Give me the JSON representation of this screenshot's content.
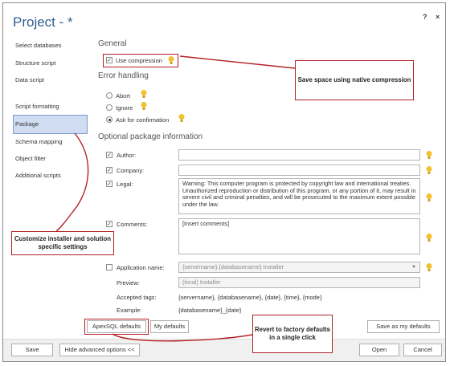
{
  "window": {
    "title": "Project - *",
    "help_label": "?",
    "close_label": "×"
  },
  "sidebar": {
    "items": [
      {
        "label": "Select databases"
      },
      {
        "label": "Structure script"
      },
      {
        "label": "Data script"
      },
      {
        "label": "Script formatting"
      },
      {
        "label": "Package"
      },
      {
        "label": "Schema mapping"
      },
      {
        "label": "Object filter"
      },
      {
        "label": "Additional scripts"
      }
    ],
    "active": "Package"
  },
  "general": {
    "heading": "General",
    "use_compression": {
      "label": "Use compression",
      "checked": true
    }
  },
  "error_handling": {
    "heading": "Error handling",
    "options": [
      {
        "label": "Abort",
        "selected": false
      },
      {
        "label": "Ignore",
        "selected": false
      },
      {
        "label": "Ask for confirmation",
        "selected": true
      }
    ]
  },
  "optional": {
    "heading": "Optional package information",
    "author": {
      "label": "Author:",
      "checked": true,
      "value": ""
    },
    "company": {
      "label": "Company:",
      "checked": true,
      "value": ""
    },
    "legal": {
      "label": "Legal:",
      "checked": true,
      "value": "Warning: This computer program is protected by copyright law and international treaties. Unauthorized reproduction or distribution of this program, or any portion of it, may result in severe civil and criminal penalties, and will be prosecuted to the maximum extent possible under the law."
    },
    "comments": {
      "label": "Comments:",
      "checked": true,
      "value": "[Insert comments]"
    },
    "application_name": {
      "label": "Application name:",
      "checked": false,
      "value": "{servername}.{databasename} Installer"
    },
    "preview": {
      "label": "Preview:",
      "value": "(local) Installer"
    },
    "accepted_tags": {
      "label": "Accepted tags:",
      "value": "{servername}, {databasename}, {date}, {time}, {mode}"
    },
    "example": {
      "label": "Example:",
      "value": "{databasename}_{date}"
    }
  },
  "buttons": {
    "apexsql_defaults": "ApexSQL defaults",
    "my_defaults": "My defaults",
    "save_as_my_defaults": "Save as my defaults",
    "save": "Save",
    "hide_advanced": "Hide advanced options <<",
    "open": "Open",
    "cancel": "Cancel"
  },
  "callouts": {
    "compression": "Save space using native compression",
    "installer": "Customize installer and solution specific settings",
    "revert": "Revert to factory defaults in a single click"
  },
  "colors": {
    "title": "#2f5e8e",
    "annotation_red": "#b32025",
    "active_nav": "#cfdcf2",
    "hint_bulb": "#f2c12e"
  }
}
